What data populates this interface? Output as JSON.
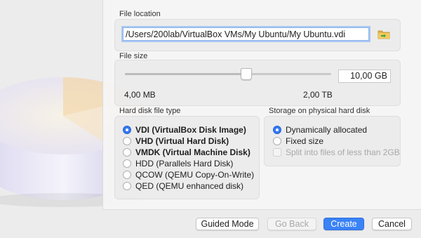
{
  "file_location": {
    "label": "File location",
    "path": "/Users/200lab/VirtualBox VMs/My Ubuntu/My Ubuntu.vdi"
  },
  "file_size": {
    "label": "File size",
    "value": "10,00 GB",
    "min_label": "4,00 MB",
    "max_label": "2,00 TB",
    "slider_fraction": 0.58
  },
  "disk_type": {
    "label": "Hard disk file type",
    "options": [
      {
        "label": "VDI (VirtualBox Disk Image)",
        "selected": true,
        "bold": true
      },
      {
        "label": "VHD (Virtual Hard Disk)",
        "selected": false,
        "bold": true
      },
      {
        "label": "VMDK (Virtual Machine Disk)",
        "selected": false,
        "bold": true
      },
      {
        "label": "HDD (Parallels Hard Disk)",
        "selected": false,
        "bold": false
      },
      {
        "label": "QCOW (QEMU Copy-On-Write)",
        "selected": false,
        "bold": false
      },
      {
        "label": "QED (QEMU enhanced disk)",
        "selected": false,
        "bold": false
      }
    ]
  },
  "storage": {
    "label": "Storage on physical hard disk",
    "options": [
      {
        "label": "Dynamically allocated",
        "selected": true
      },
      {
        "label": "Fixed size",
        "selected": false
      }
    ],
    "split_label": "Split into files of less than 2GB",
    "split_enabled": false
  },
  "buttons": {
    "guided": "Guided Mode",
    "back": "Go Back",
    "create": "Create",
    "cancel": "Cancel"
  },
  "colors": {
    "accent": "#3478f6",
    "primary_button": "#3a82f7"
  },
  "icons": [
    "folder-icon"
  ]
}
